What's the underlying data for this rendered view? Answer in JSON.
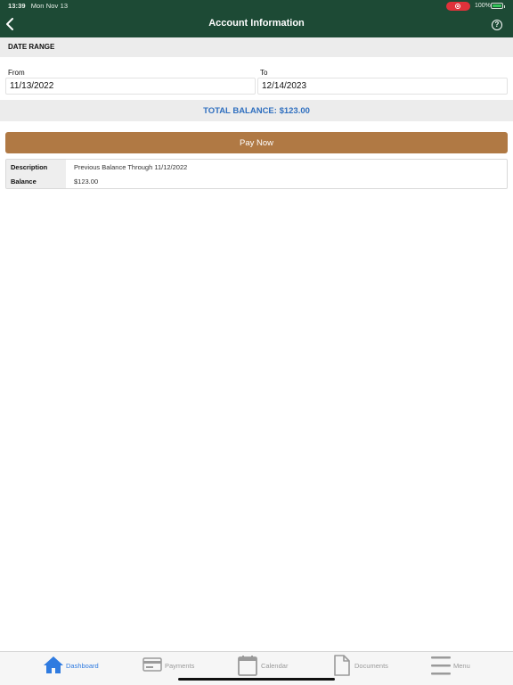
{
  "status_bar": {
    "time": "13:39",
    "date": "Mon Nov 13",
    "battery": "100%"
  },
  "header": {
    "title": "Account Information"
  },
  "date_range": {
    "section_title": "DATE RANGE",
    "from_label": "From",
    "from_value": "11/13/2022",
    "to_label": "To",
    "to_value": "12/14/2023"
  },
  "balance": {
    "text": "TOTAL BALANCE: $123.00"
  },
  "pay_button": {
    "label": "Pay Now"
  },
  "details": [
    {
      "key": "Description",
      "value": "Previous Balance Through 11/12/2022"
    },
    {
      "key": "Balance",
      "value": "$123.00"
    }
  ],
  "tabs": [
    {
      "label": "Dashboard",
      "icon": "home-icon",
      "active": true
    },
    {
      "label": "Payments",
      "icon": "credit-card-icon",
      "active": false
    },
    {
      "label": "Calendar",
      "icon": "calendar-icon",
      "active": false
    },
    {
      "label": "Documents",
      "icon": "document-icon",
      "active": false
    },
    {
      "label": "Menu",
      "icon": "menu-icon",
      "active": false
    }
  ],
  "colors": {
    "header_bg": "#1d4a35",
    "pay_button_bg": "#b07944",
    "balance_text": "#2f6fbf",
    "tab_active": "#2f7be0",
    "tab_inactive": "#9a9a9a"
  }
}
